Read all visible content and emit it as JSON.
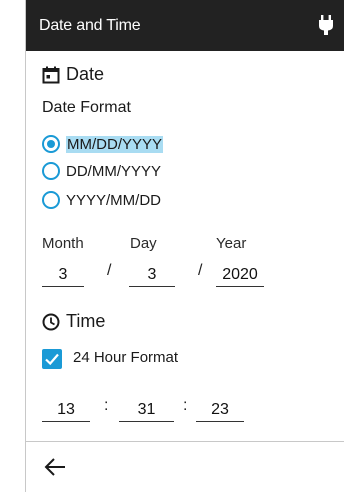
{
  "header": {
    "title": "Date and Time",
    "status_icon": "plug-icon"
  },
  "date_section": {
    "title": "Date",
    "icon": "calendar-icon",
    "format_label": "Date Format",
    "formats": [
      {
        "label": "MM/DD/YYYY",
        "selected": true
      },
      {
        "label": "DD/MM/YYYY",
        "selected": false
      },
      {
        "label": "YYYY/MM/DD",
        "selected": false
      }
    ],
    "month_label": "Month",
    "day_label": "Day",
    "year_label": "Year",
    "month_value": "3",
    "day_value": "3",
    "year_value": "2020",
    "separator": "/"
  },
  "time_section": {
    "title": "Time",
    "icon": "clock-icon",
    "hour24_label": "24 Hour Format",
    "hour24_checked": true,
    "hour_value": "13",
    "minute_value": "31",
    "second_value": "23",
    "separator": ":"
  },
  "footer": {
    "back_icon": "back-arrow-icon"
  },
  "colors": {
    "accent": "#1a9ad6",
    "header_bg": "#222222",
    "highlight": "#a9dcf2"
  }
}
